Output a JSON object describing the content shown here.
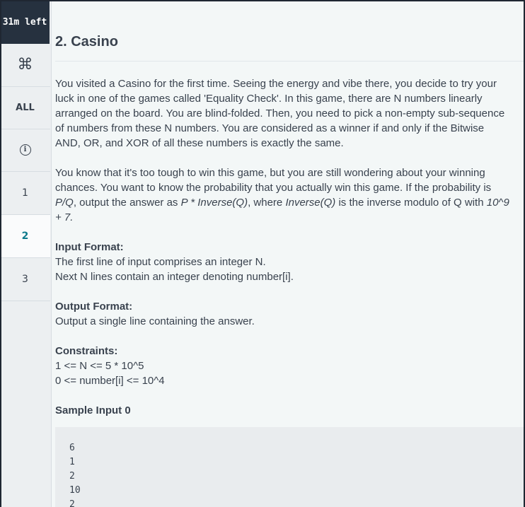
{
  "sidebar": {
    "timer": "31m left",
    "shortcut_icon": "command-icon",
    "all_label": "ALL",
    "info_icon": "info-icon",
    "questions": [
      "1",
      "2",
      "3"
    ],
    "active_question": "2"
  },
  "problem": {
    "title": "2. Casino",
    "paragraph1": [
      "You visited a Casino for the first time. Seeing the energy and vibe there, you decide to try your",
      "luck in one of the games called 'Equality Check'. In this game, there are N numbers linearly",
      "arranged on the board. You are blind-folded. Then, you need to pick a non-empty sub-sequence",
      "of numbers from these N numbers. You are considered as a winner if and only if the Bitwise",
      "AND, OR, and XOR of all these numbers is exactly the same."
    ],
    "paragraph2": {
      "line1": "You know that it's too tough to win this game, but you are still wondering about your winning",
      "line2": "chances. You want to know the probability that you actually win this game. If the probability is",
      "line3_part1": "P/Q",
      "line3_part2": ", output the answer as ",
      "line3_part3": "P * Inverse(Q)",
      "line3_part4": ", where ",
      "line3_part5": "Inverse(Q)",
      "line3_part6": " is the inverse modulo of Q with ",
      "line3_part7": "10^9",
      "line4": "+ 7."
    },
    "input_format": {
      "heading": "Input Format:",
      "lines": [
        "The first line of input comprises an integer N.",
        "Next N lines contain an integer denoting number[i]."
      ]
    },
    "output_format": {
      "heading": "Output Format:",
      "lines": [
        "Output a single line containing the answer."
      ]
    },
    "constraints": {
      "heading": "Constraints:",
      "lines": [
        "1 <= N <= 5 * 10^5",
        "0 <= number[i] <= 10^4"
      ]
    },
    "sample_input": {
      "heading": "Sample Input 0",
      "lines": [
        "6",
        "1",
        "2",
        "10",
        "2"
      ]
    }
  }
}
